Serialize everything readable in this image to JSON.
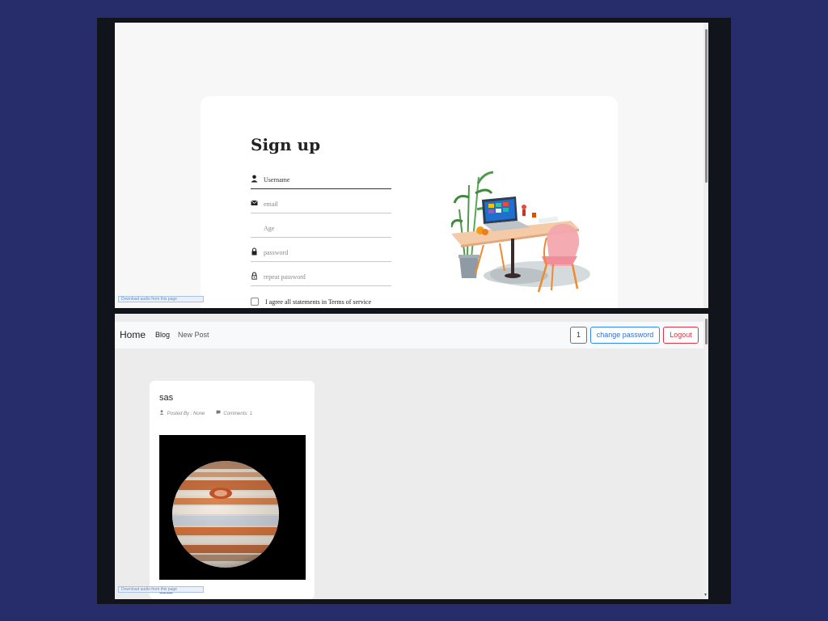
{
  "signup": {
    "title": "Sign up",
    "fields": {
      "username": {
        "placeholder": "Username",
        "icon": "person-icon"
      },
      "email": {
        "placeholder": "email",
        "icon": "envelope-icon"
      },
      "age": {
        "placeholder": "Age"
      },
      "password": {
        "placeholder": "password",
        "icon": "lock-icon"
      },
      "repeat_password": {
        "placeholder": "repeat password",
        "icon": "lock-outline-icon"
      }
    },
    "agree_label": "I agree all statements in Terms of service"
  },
  "download_bar": {
    "label": "Download audio from this page"
  },
  "navbar": {
    "brand": "Home",
    "links": [
      "Blog",
      "New Post"
    ],
    "count_button": "1",
    "change_password_button": "change password",
    "logout_button": "Logout"
  },
  "post": {
    "title": "sas",
    "posted_by": "Posted By : None",
    "comments": "Comments: 1",
    "body": "asas",
    "image": "jupiter-planet"
  },
  "colors": {
    "outer_background": "#272d6b",
    "primary": "#2f86f6",
    "danger": "#dc3545",
    "secondary": "#6c757d"
  }
}
